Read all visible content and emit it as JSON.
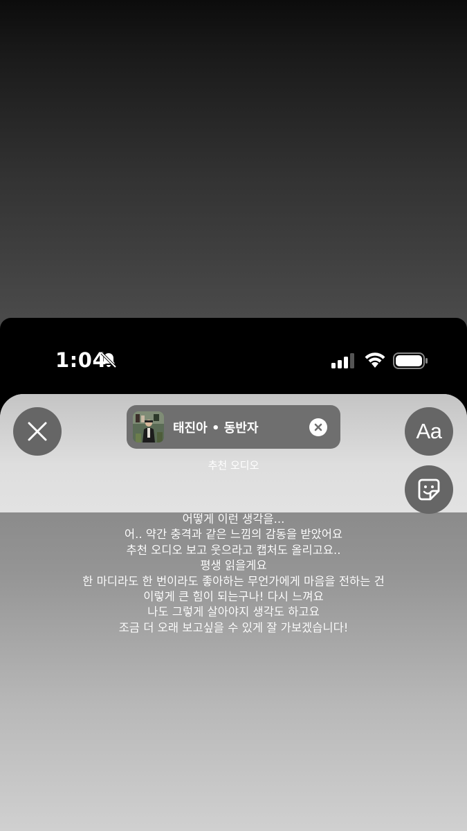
{
  "status_bar": {
    "time": "1:04",
    "silent_icon": "bell-slash-icon",
    "signal_icon": "cellular-signal-icon",
    "wifi_icon": "wifi-icon",
    "battery_icon": "battery-icon"
  },
  "editor": {
    "close_icon": "close-icon",
    "text_tool_label": "Aa",
    "sticker_icon": "sticker-icon",
    "music": {
      "title": "태진아 • 동반자",
      "album_art_icon": "album-art",
      "remove_icon": "remove-circle-icon"
    },
    "audio_label": "추천 오디오"
  },
  "story": {
    "lines": [
      "어떻게 이런 생각을...",
      "어.. 약간 충격과 같은 느낌의 감동을 받았어요",
      "추천 오디오 보고 웃으라고 캡처도 올리고요..",
      "평생 읽을게요",
      "한 마디라도 한 번이라도 좋아하는 무언가에게 마음을 전하는 건",
      "이렇게 큰 힘이 되는구나! 다시 느껴요",
      "나도 그렇게 살아야지 생각도 하고요",
      "조금 더 오래 보고싶을 수 있게 잘 가보겠습니다!"
    ]
  },
  "colors": {
    "button_bg": "#666666",
    "pill_bg": "#6f6f6f",
    "text": "#ffffff"
  }
}
